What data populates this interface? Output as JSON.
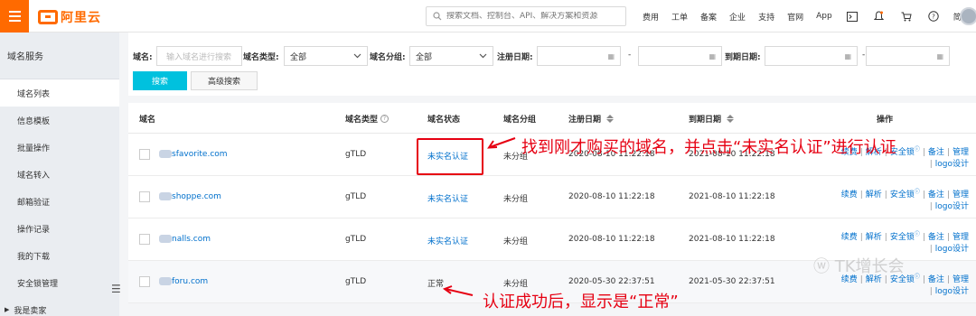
{
  "app": {
    "logo_text": "阿里云"
  },
  "search": {
    "placeholder": "搜索文档、控制台、API、解决方案和资源"
  },
  "top_nav": {
    "links": [
      "费用",
      "工单",
      "备案",
      "企业",
      "支持",
      "官网",
      "App"
    ],
    "lang": "简体"
  },
  "sidebar": {
    "title": "域名服务",
    "items": [
      {
        "label": "域名列表",
        "active": true
      },
      {
        "label": "信息模板"
      },
      {
        "label": "批量操作"
      },
      {
        "label": "域名转入"
      },
      {
        "label": "邮箱验证"
      },
      {
        "label": "操作记录"
      },
      {
        "label": "我的下载"
      },
      {
        "label": "安全锁管理"
      },
      {
        "label": "我是卖家"
      }
    ]
  },
  "filters": {
    "domain_label": "域名:",
    "domain_placeholder": "输入域名进行搜索",
    "type_label": "域名类型:",
    "type_value": "全部",
    "group_label": "域名分组:",
    "group_value": "全部",
    "reg_date_label": "注册日期:",
    "exp_date_label": "到期日期:",
    "dash": "-",
    "search_button": "搜索",
    "advanced_button": "高级搜索"
  },
  "table": {
    "columns": {
      "domain": "域名",
      "type": "域名类型",
      "status": "域名状态",
      "group": "域名分组",
      "reg_date": "注册日期",
      "exp_date": "到期日期",
      "ops": "操作"
    },
    "rows": [
      {
        "domain": "sfavorite.com",
        "type": "gTLD",
        "status": "未实名认证",
        "group": "未分组",
        "reg_date": "2020-08-10 11:22:18",
        "exp_date": "2021-08-10 11:22:18"
      },
      {
        "domain": "shoppe.com",
        "type": "gTLD",
        "status": "未实名认证",
        "group": "未分组",
        "reg_date": "2020-08-10 11:22:18",
        "exp_date": "2021-08-10 11:22:18"
      },
      {
        "domain": "nalls.com",
        "type": "gTLD",
        "status": "未实名认证",
        "group": "未分组",
        "reg_date": "2020-08-10 11:22:18",
        "exp_date": "2021-08-10 11:22:18"
      },
      {
        "domain": "foru.com",
        "type": "gTLD",
        "status": "正常",
        "group": "未分组",
        "reg_date": "2020-05-30 22:37:51",
        "exp_date": "2021-05-30 22:37:51"
      }
    ],
    "ops": {
      "renew": "续费",
      "resolve": "解析",
      "lock": "安全锁",
      "note": "备注",
      "manage": "管理",
      "logo": "logo设计",
      "sep": "|"
    }
  },
  "annotations": {
    "top": "找到刚才购买的域名，并点击“未实名认证”进行认证",
    "bottom": "认证成功后，显示是“正常”",
    "watermark": "TK增长会"
  },
  "colors": {
    "brand": "#ff6a00",
    "link": "#0070cc",
    "primary_button": "#00c1de",
    "annotation": "#e60012"
  }
}
